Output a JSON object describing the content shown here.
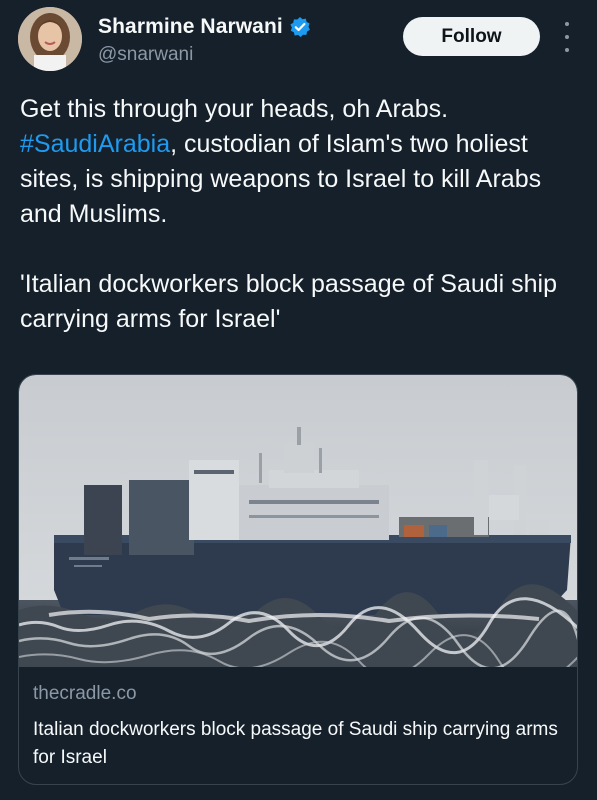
{
  "author": {
    "display_name": "Sharmine Narwani",
    "handle": "@snarwani",
    "avatar_icon": "avatar-photo",
    "verified_icon": "verified-badge-icon"
  },
  "actions": {
    "follow_label": "Follow",
    "more_icon": "more-options-icon"
  },
  "tweet": {
    "line1": "Get this through your heads, oh Arabs.",
    "hashtag": "#SaudiArabia",
    "line2_rest": ", custodian of Islam's two holiest sites, is shipping weapons to Israel to kill Arabs and Muslims.",
    "quote": "'Italian dockworkers block passage of Saudi ship carrying arms for Israel'"
  },
  "link_card": {
    "image_description_icon": "ship-photo",
    "domain": "thecradle.co",
    "title": "Italian dockworkers block passage of Saudi ship carrying arms for Israel"
  },
  "colors": {
    "background": "#15202b",
    "accent_link": "#1d9bf0",
    "secondary_text": "#8b98a5",
    "border": "#38444d"
  }
}
